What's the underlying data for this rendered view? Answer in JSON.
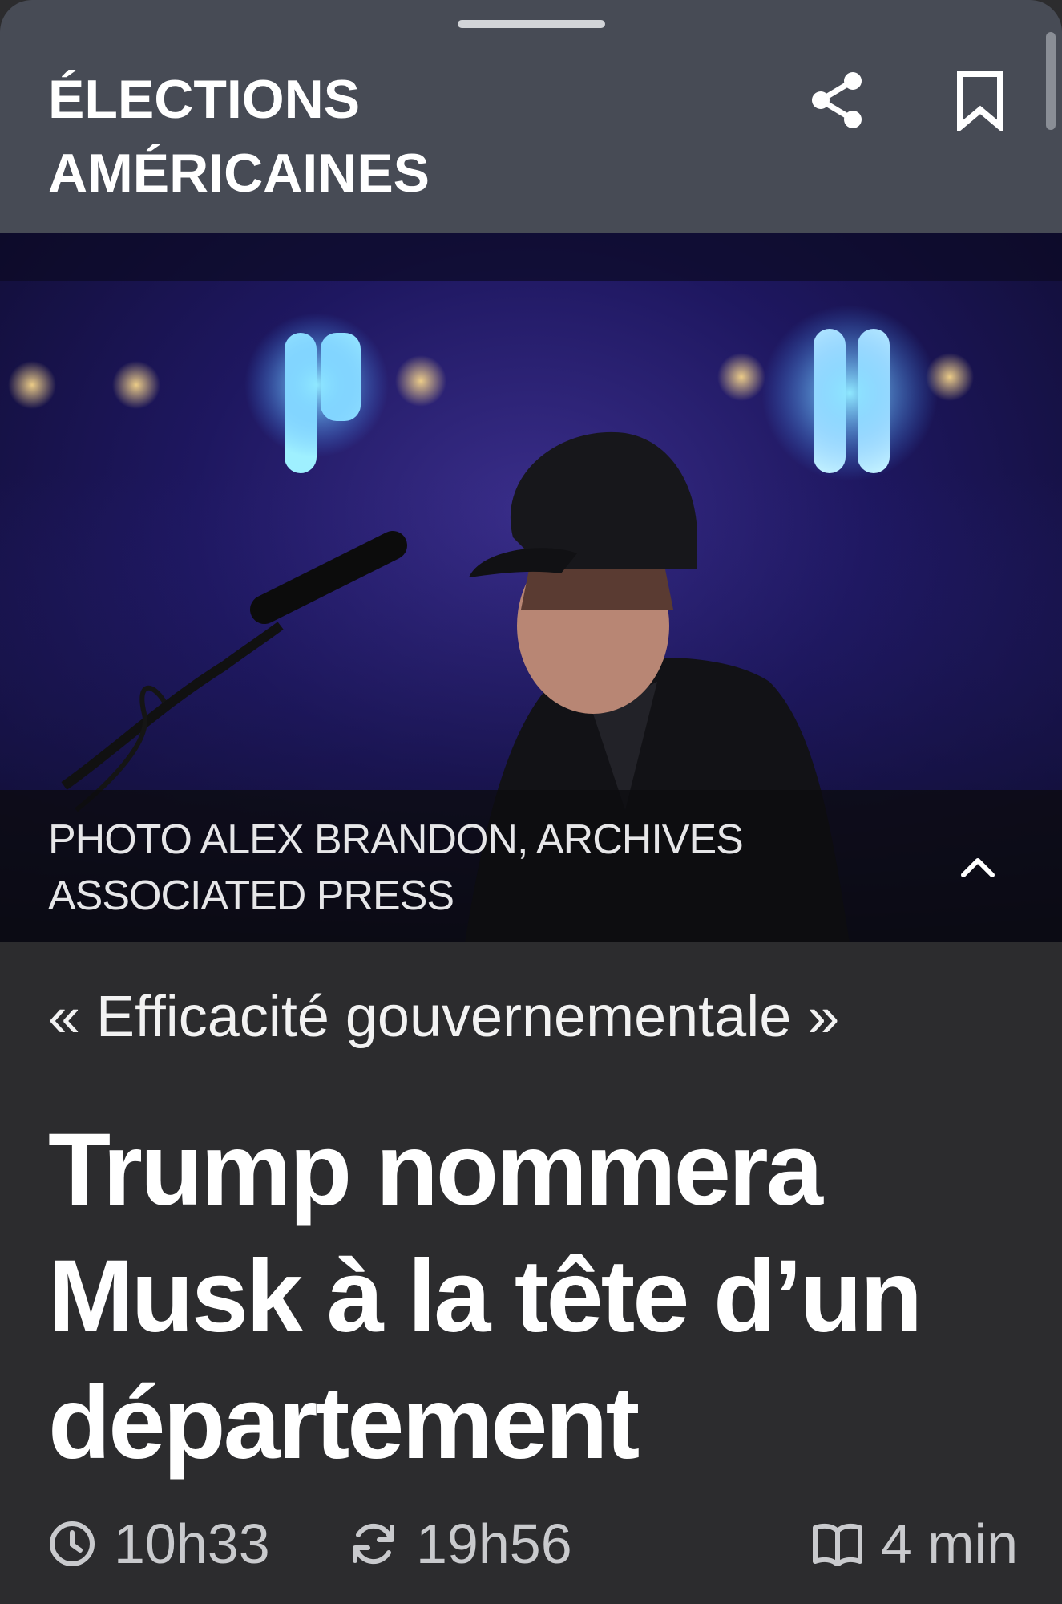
{
  "header": {
    "section_title": "ÉLECTIONS AMÉRICAINES"
  },
  "hero": {
    "credit": "PHOTO ALEX BRANDON, ARCHIVES ASSOCIATED PRESS"
  },
  "article": {
    "kicker": "« Efficacité gouvernementale »",
    "headline": "Trump nommera Musk à la tête d’un département",
    "published_time": "10h33",
    "updated_time": "19h56",
    "read_time": "4 min"
  },
  "icons": {
    "share": "share-icon",
    "bookmark": "bookmark-icon",
    "caption_toggle": "chevron-up-icon",
    "published": "clock-icon",
    "updated": "refresh-icon",
    "read_time": "book-icon"
  }
}
